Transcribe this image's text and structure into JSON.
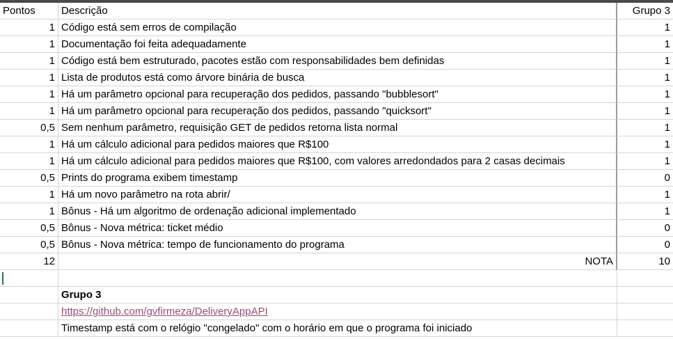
{
  "headers": {
    "pontos": "Pontos",
    "descricao": "Descrição",
    "grupo": "Grupo 3"
  },
  "rows": [
    {
      "pontos": "1",
      "descricao": "Código está sem erros de compilação",
      "grupo": "1"
    },
    {
      "pontos": "1",
      "descricao": "Documentação foi feita adequadamente",
      "grupo": "1"
    },
    {
      "pontos": "1",
      "descricao": "Código está bem estruturado, pacotes estão com responsabilidades bem definidas",
      "grupo": "1"
    },
    {
      "pontos": "1",
      "descricao": "Lista de produtos está como árvore binária de busca",
      "grupo": "1"
    },
    {
      "pontos": "1",
      "descricao": "Há um parâmetro opcional para recuperação dos pedidos, passando \"bubblesort\"",
      "grupo": "1"
    },
    {
      "pontos": "1",
      "descricao": "Há um parâmetro opcional para recuperação dos pedidos, passando \"quicksort\"",
      "grupo": "1"
    },
    {
      "pontos": "0,5",
      "descricao": "Sem nenhum parâmetro, requisição GET de pedidos retorna lista normal",
      "grupo": "1"
    },
    {
      "pontos": "1",
      "descricao": "Há um cálculo adicional para pedidos maiores que R$100",
      "grupo": "1"
    },
    {
      "pontos": "1",
      "descricao": "Há um cálculo adicional para pedidos maiores que R$100, com valores arredondados para 2 casas decimais",
      "grupo": "1"
    },
    {
      "pontos": "0,5",
      "descricao": "Prints do programa exibem timestamp",
      "grupo": "0"
    },
    {
      "pontos": "1",
      "descricao": "Há um novo parâmetro na rota abrir/",
      "grupo": "1"
    },
    {
      "pontos": "1",
      "descricao": "Bônus - Há um algoritmo de ordenação adicional implementado",
      "grupo": "1"
    },
    {
      "pontos": "0,5",
      "descricao": "Bônus - Nova métrica: ticket médio",
      "grupo": "0"
    },
    {
      "pontos": "0,5",
      "descricao": "Bônus - Nova métrica: tempo de funcionamento do programa",
      "grupo": "0"
    }
  ],
  "total": {
    "pontos": "12",
    "label": "NOTA",
    "grupo": "10"
  },
  "notes": {
    "title": "Grupo 3",
    "link": "https://github.com/gvfirmeza/DeliveryAppAPI",
    "comment": "Timestamp está com o relógio \"congelado\" com o horário em que o programa foi iniciado"
  }
}
